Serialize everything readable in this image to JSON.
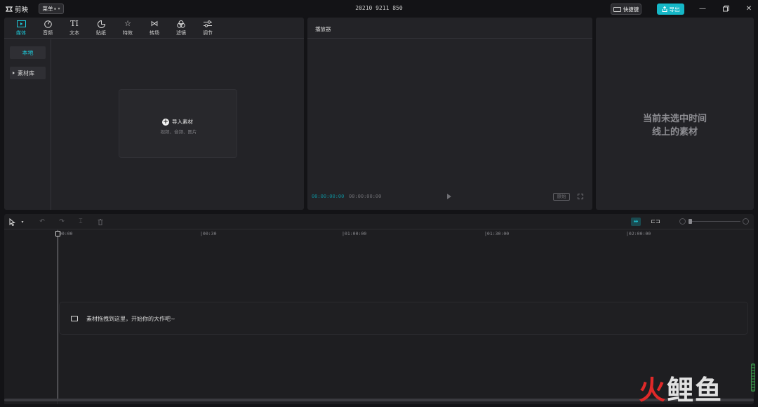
{
  "app": {
    "name": "剪映",
    "menu_label": "菜单",
    "project_name": "20210 9211 850",
    "shortcut_label": "快捷键",
    "export_label": "导出",
    "accent_color": "#1ec8d8"
  },
  "media_panel": {
    "tabs": [
      {
        "label": "媒体",
        "icon": "media-icon",
        "active": true
      },
      {
        "label": "音频",
        "icon": "audio-icon",
        "active": false
      },
      {
        "label": "文本",
        "icon": "text-icon",
        "active": false
      },
      {
        "label": "贴纸",
        "icon": "sticker-icon",
        "active": false
      },
      {
        "label": "特效",
        "icon": "effects-icon",
        "active": false
      },
      {
        "label": "转场",
        "icon": "transition-icon",
        "active": false
      },
      {
        "label": "滤镜",
        "icon": "filter-icon",
        "active": false
      },
      {
        "label": "调节",
        "icon": "adjust-icon",
        "active": false
      }
    ],
    "sidebar": {
      "local_label": "本地",
      "library_label": "素材库"
    },
    "import": {
      "title": "导入素材",
      "subtitle": "视频、音频、图片"
    }
  },
  "player": {
    "title": "播放器",
    "current_time": "00:00:00:00",
    "total_time": "00:00:00:00",
    "ratio_label": "原始"
  },
  "detail": {
    "empty_line1": "当前未选中时间",
    "empty_line2": "线上的素材"
  },
  "timeline": {
    "ruler_ticks": [
      "00:00",
      "|00:30",
      "|01:00:00",
      "|01:30:00",
      "|02:00:00"
    ],
    "drop_hint": "素材拖拽到这里，开始你的大作吧~"
  },
  "watermark": {
    "red_part": "火",
    "white_part": "鲤鱼"
  }
}
